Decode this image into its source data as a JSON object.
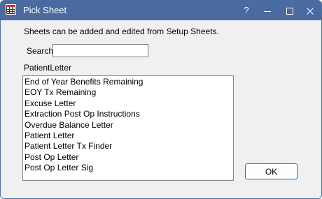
{
  "window": {
    "title": "Pick Sheet",
    "help_label": "?",
    "minimize_label": "—",
    "maximize_label": "☐",
    "close_label": "✕"
  },
  "info_text": "Sheets can be added and edited from Setup Sheets.",
  "search": {
    "label": "Search",
    "value": "",
    "placeholder": ""
  },
  "selected_label": "PatientLetter",
  "sheets": [
    "End of Year Benefits Remaining",
    "EOY Tx Remaining",
    "Excuse Letter",
    "Extraction Post Op Instructions",
    "Overdue Balance Letter",
    "Patient Letter",
    "Patient Letter Tx Finder",
    "Post Op Letter",
    "Post Op Letter Sig"
  ],
  "ok_label": "OK",
  "colors": {
    "titlebar": "#4b6aa0",
    "dialog_background": "#f0f0f0",
    "ok_border": "#0078d7"
  }
}
